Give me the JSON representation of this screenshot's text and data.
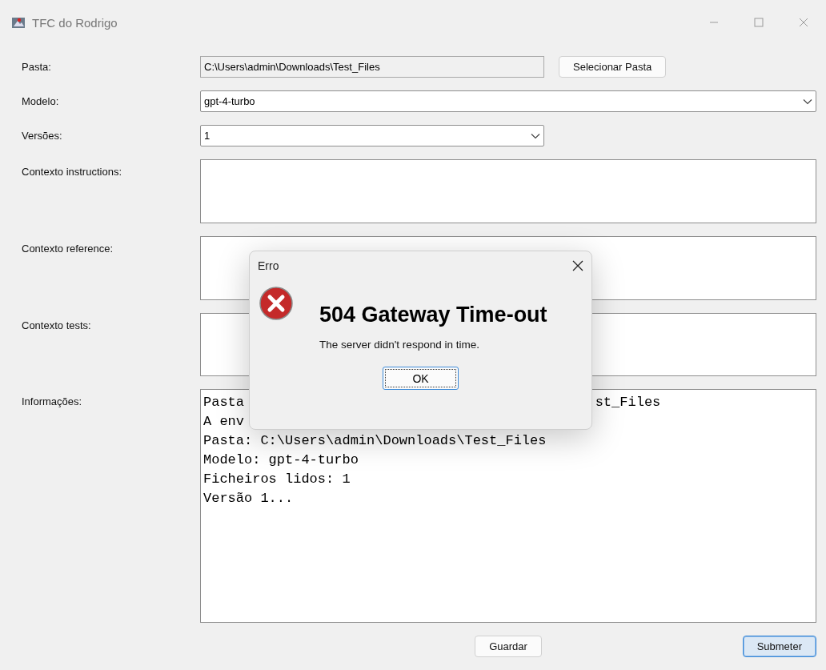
{
  "window": {
    "title": "TFC do Rodrigo"
  },
  "fields": [
    {
      "kind": "path",
      "label": "Pasta:",
      "value": "C:\\Users\\admin\\Downloads\\Test_Files",
      "button": "Selecionar Pasta"
    },
    {
      "kind": "select-wide",
      "label": "Modelo:",
      "value": "gpt-4-turbo"
    },
    {
      "kind": "select",
      "label": "Versões:",
      "value": "1"
    },
    {
      "kind": "textarea",
      "label": "Contexto instructions:"
    },
    {
      "kind": "textarea",
      "label": "Contexto reference:"
    },
    {
      "kind": "textarea",
      "label": "Contexto tests:"
    },
    {
      "kind": "log",
      "label": "Informações:",
      "lines": [
        {
          "text": "Pasta",
          "tail": "st_Files"
        },
        {
          "text": "A env"
        },
        {
          "text": "Pasta: C:\\Users\\admin\\Downloads\\Test_Files"
        },
        {
          "text": "Modelo: gpt-4-turbo"
        },
        {
          "text": "Ficheiros lidos: 1"
        },
        {
          "text": "Versão 1..."
        }
      ]
    }
  ],
  "buttons": [
    {
      "label": "Guardar",
      "default": false
    },
    {
      "label": "Submeter",
      "default": true
    }
  ],
  "dialog": {
    "title": "Erro",
    "heading": "504 Gateway Time-out",
    "message": "The server didn't respond in time.",
    "button": "OK"
  }
}
